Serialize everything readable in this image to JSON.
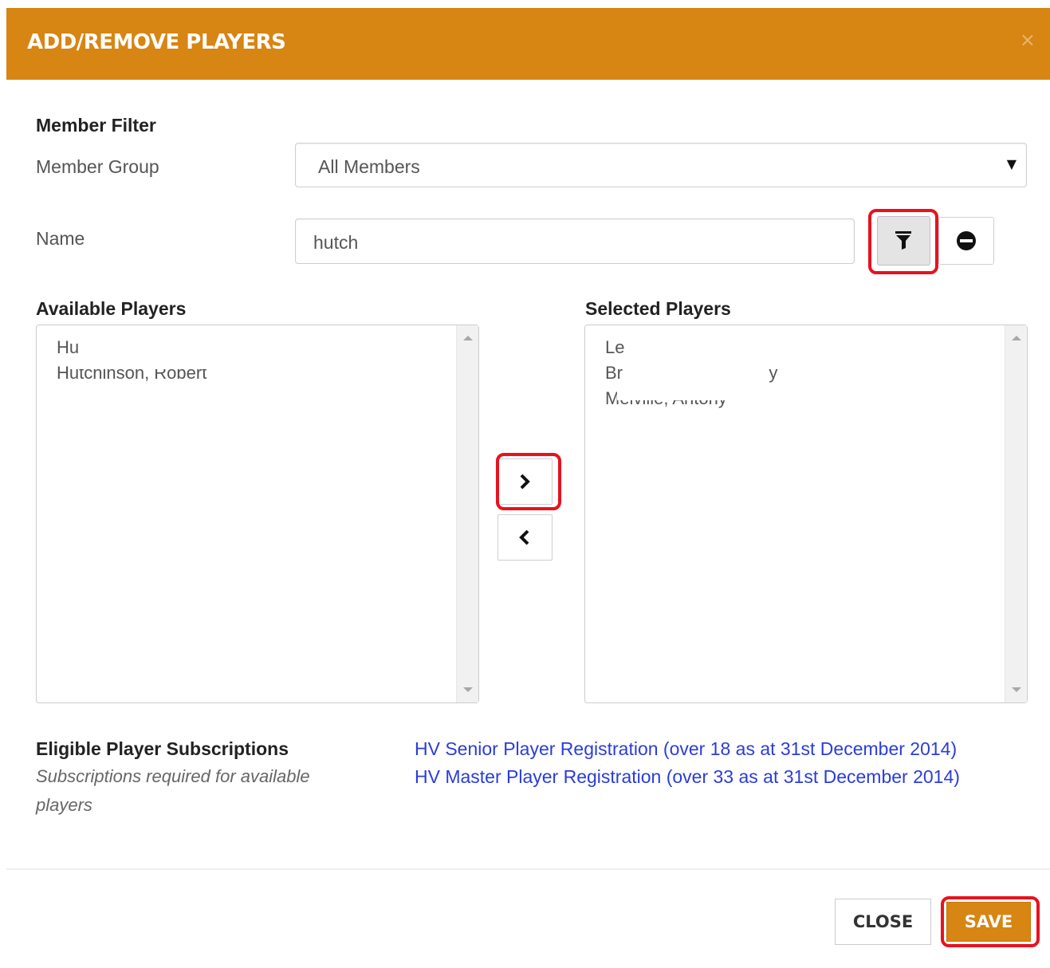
{
  "modal": {
    "title": "ADD/REMOVE PLAYERS",
    "close_icon": "×"
  },
  "filter": {
    "heading": "Member Filter",
    "group_label": "Member Group",
    "group_value": "All Members",
    "name_label": "Name",
    "name_value": "hutch"
  },
  "available": {
    "heading": "Available Players",
    "items": [
      "Hu",
      "Hutchinson, Robert"
    ]
  },
  "selected": {
    "heading": "Selected Players",
    "items": [
      "Le",
      "Br                              y",
      "Melville, Antony"
    ]
  },
  "subscriptions": {
    "heading": "Eligible Player Subscriptions",
    "note": "Subscriptions required for available players",
    "links": [
      "HV Senior Player Registration (over 18 as at 31st December 2014)",
      "HV Master Player Registration (over 33 as at 31st December 2014)"
    ]
  },
  "footer": {
    "close_label": "CLOSE",
    "save_label": "SAVE"
  },
  "colors": {
    "accent": "#d78513",
    "highlight": "#e8121f",
    "link": "#2a3dd9"
  }
}
